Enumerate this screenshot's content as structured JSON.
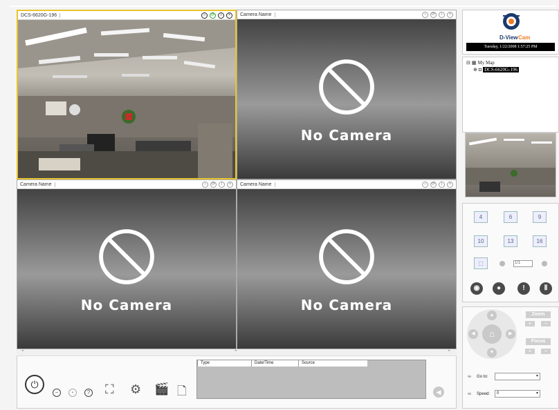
{
  "cameras": [
    {
      "name": "DCS-6620G-196",
      "controls": [
        "circle-icon",
        "refresh-icon",
        "info-icon",
        "close-icon"
      ]
    },
    {
      "name": "Camera Name",
      "status": "No Camera"
    },
    {
      "name": "Camera Name",
      "status": "No Camera"
    },
    {
      "name": "Camera Name",
      "status": "No Camera"
    }
  ],
  "brand": {
    "name_part1": "D-View",
    "name_part2": "Cam"
  },
  "datetime": "Tuesday, 1/22/2008 1:57:25 PM",
  "map_tree": {
    "root": "My Map",
    "device": "DCS-6620G-196"
  },
  "layout_buttons": [
    "4",
    "6",
    "9",
    "10",
    "13",
    "16"
  ],
  "pager": {
    "value": "1/1"
  },
  "ptz": {
    "zoom_label": "Zoom",
    "focus_label": "Focus",
    "plus": "+",
    "minus": "−",
    "goto_label": "Go to:",
    "goto_value": "",
    "speed_label": "Speed:",
    "speed_value": "0"
  },
  "events": {
    "columns": [
      "Type",
      "Date/Time",
      "Source"
    ]
  },
  "colors": {
    "selected_border": "#e7c42c",
    "brand_orange": "#f47a20",
    "brand_blue": "#1b3a6b"
  }
}
